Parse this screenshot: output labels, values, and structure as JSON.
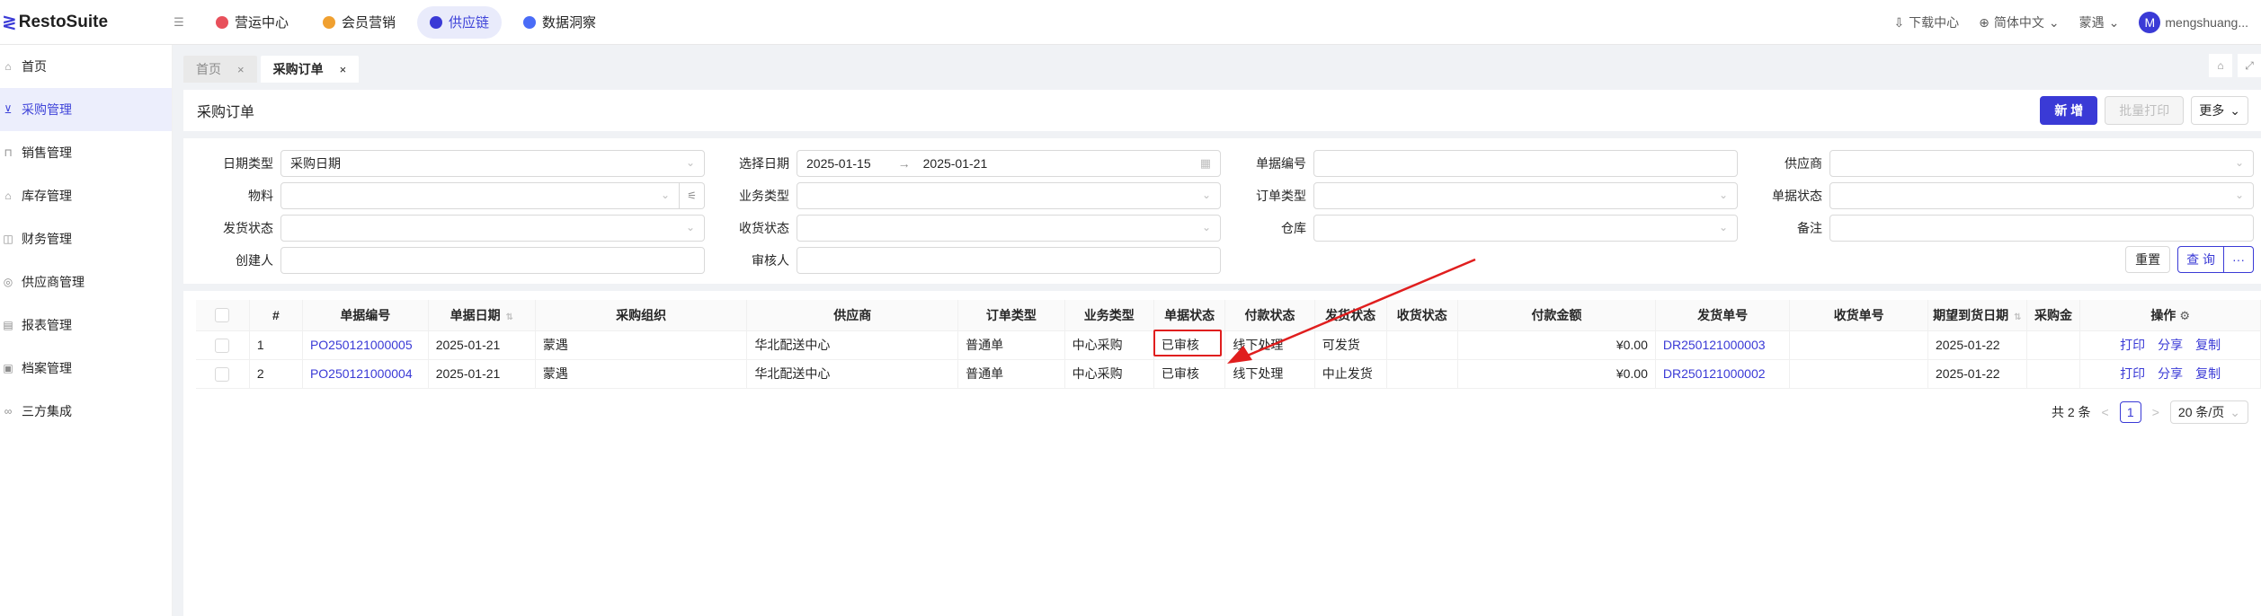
{
  "app": {
    "logo_mark": "≷",
    "name": "RestoSuite"
  },
  "topnav": [
    {
      "label": "营运中心",
      "color": "#e8505b",
      "active": false
    },
    {
      "label": "会员营销",
      "color": "#f0a030",
      "active": false
    },
    {
      "label": "供应链",
      "color": "#3a3ad6",
      "active": true
    },
    {
      "label": "数据洞察",
      "color": "#4a6cf7",
      "active": false
    }
  ],
  "topright": {
    "download": "下载中心",
    "language": "简体中文",
    "store": "蒙遇",
    "user_initial": "M",
    "user": "mengshuang..."
  },
  "sidebar": [
    {
      "label": "首页",
      "icon": "home-icon",
      "glyph": "⌂"
    },
    {
      "label": "采购管理",
      "icon": "cart-icon",
      "glyph": "⊻",
      "active": true
    },
    {
      "label": "销售管理",
      "icon": "bag-icon",
      "glyph": "⊓"
    },
    {
      "label": "库存管理",
      "icon": "warehouse-icon",
      "glyph": "⌂"
    },
    {
      "label": "财务管理",
      "icon": "finance-icon",
      "glyph": "◫"
    },
    {
      "label": "供应商管理",
      "icon": "supplier-icon",
      "glyph": "◎"
    },
    {
      "label": "报表管理",
      "icon": "report-icon",
      "glyph": "▤"
    },
    {
      "label": "档案管理",
      "icon": "archive-icon",
      "glyph": "▣"
    },
    {
      "label": "三方集成",
      "icon": "integration-icon",
      "glyph": "∞"
    }
  ],
  "tabs": [
    {
      "label": "首页",
      "close": "×"
    },
    {
      "label": "采购订单",
      "close": "×",
      "active": true
    }
  ],
  "header": {
    "title": "采购订单",
    "new_btn": "新 增",
    "batch_print": "批量打印",
    "more": "更多"
  },
  "filters": {
    "date_type_label": "日期类型",
    "date_type_value": "采购日期",
    "select_date_label": "选择日期",
    "date_start": "2025-01-15",
    "date_sep": "→",
    "date_end": "2025-01-21",
    "doc_no_label": "单据编号",
    "supplier_label": "供应商",
    "material_label": "物料",
    "biz_type_label": "业务类型",
    "order_type_label": "订单类型",
    "doc_status_label": "单据状态",
    "ship_status_label": "发货状态",
    "recv_status_label": "收货状态",
    "warehouse_label": "仓库",
    "remark_label": "备注",
    "creator_label": "创建人",
    "reviewer_label": "审核人",
    "reset_btn": "重置",
    "query_btn": "查 询",
    "more_btn": "···"
  },
  "table": {
    "headers": [
      "#",
      "单据编号",
      "单据日期",
      "采购组织",
      "供应商",
      "订单类型",
      "业务类型",
      "单据状态",
      "付款状态",
      "发货状态",
      "收货状态",
      "付款金额",
      "发货单号",
      "收货单号",
      "期望到货日期",
      "采购金",
      "操作"
    ],
    "rows": [
      {
        "no": "1",
        "doc_no": "PO250121000005",
        "date": "2025-01-21",
        "org": "蒙遇",
        "supplier": "华北配送中心",
        "order_type": "普通单",
        "biz_type": "中心采购",
        "doc_status": "已审核",
        "pay_status": "线下处理",
        "ship_status": "可发货",
        "recv_status": "",
        "amount": "¥0.00",
        "ship_no": "DR250121000003",
        "recv_no": "",
        "expected": "2025-01-22",
        "purchase_amount": ""
      },
      {
        "no": "2",
        "doc_no": "PO250121000004",
        "date": "2025-01-21",
        "org": "蒙遇",
        "supplier": "华北配送中心",
        "order_type": "普通单",
        "biz_type": "中心采购",
        "doc_status": "已审核",
        "pay_status": "线下处理",
        "ship_status": "中止发货",
        "recv_status": "",
        "amount": "¥0.00",
        "ship_no": "DR250121000002",
        "recv_no": "",
        "expected": "2025-01-22",
        "purchase_amount": ""
      }
    ],
    "ops": {
      "print": "打印",
      "share": "分享",
      "copy": "复制"
    }
  },
  "pagination": {
    "total": "共 2 条",
    "prev": "<",
    "page": "1",
    "next": ">",
    "page_size": "20 条/页"
  },
  "annotation_color": "#e01e1e"
}
